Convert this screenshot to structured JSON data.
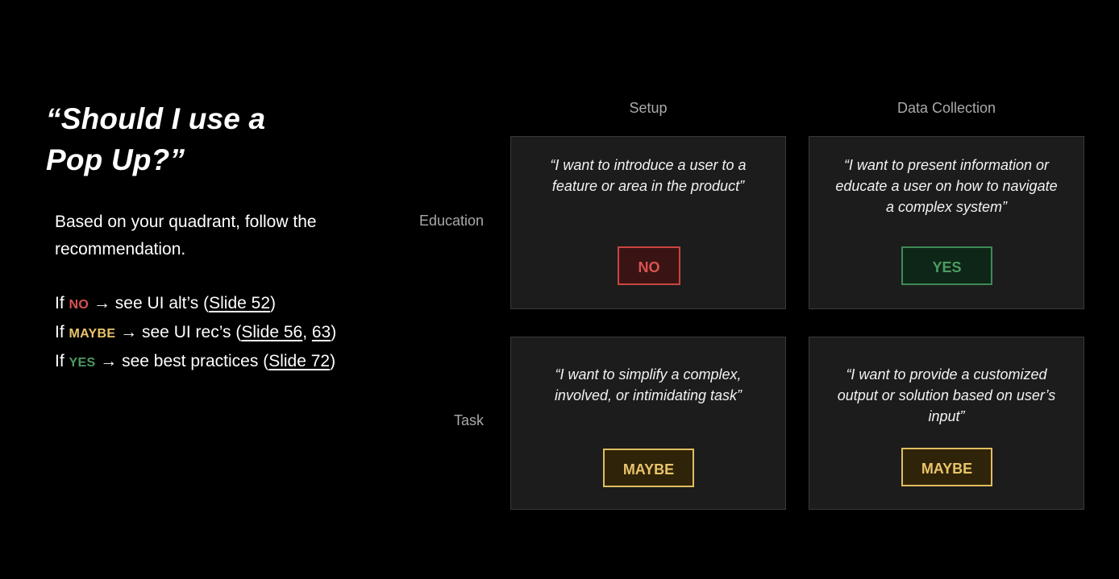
{
  "title": {
    "line1": "“Should I use a",
    "line2": "Pop Up?”"
  },
  "intro": {
    "line1": "Based on your quadrant, follow the",
    "line2": "recommendation."
  },
  "rules": [
    {
      "prefix": "If ",
      "keyword": "NO",
      "middle": " → see UI alt’s (",
      "link1": "Slide 52",
      "sep": "",
      "link2": "",
      "suffix": ")"
    },
    {
      "prefix": "If ",
      "keyword": "MAYBE",
      "middle": " → see UI rec’s (",
      "link1": "Slide 56",
      "sep": ", ",
      "link2": "63",
      "suffix": ")"
    },
    {
      "prefix": "If ",
      "keyword": "YES",
      "middle": " → see best practices (",
      "link1": "Slide 72",
      "sep": "",
      "link2": "",
      "suffix": ")"
    }
  ],
  "columns": {
    "setup": "Setup",
    "data_collection": "Data Collection"
  },
  "rows": {
    "education": "Education",
    "task": "Task"
  },
  "quadrants": {
    "education_setup": {
      "quote": "“I want to introduce a user to a feature or area in the product”",
      "verdict": "NO"
    },
    "education_data": {
      "quote": "“I want to present information or educate a user on how to navigate a complex system”",
      "verdict": "YES"
    },
    "task_setup": {
      "quote": "“I want to simplify a complex, involved, or intimidating task”",
      "verdict": "MAYBE"
    },
    "task_data": {
      "quote": "“I want to provide a customized output or solution based on user’s input”",
      "verdict": "MAYBE"
    }
  },
  "colors": {
    "background": "#000000",
    "card": "#1c1c1c",
    "no": "#d9534f",
    "yes": "#4e9a62",
    "maybe": "#e9c46a",
    "header_text": "#a9a9a9"
  }
}
